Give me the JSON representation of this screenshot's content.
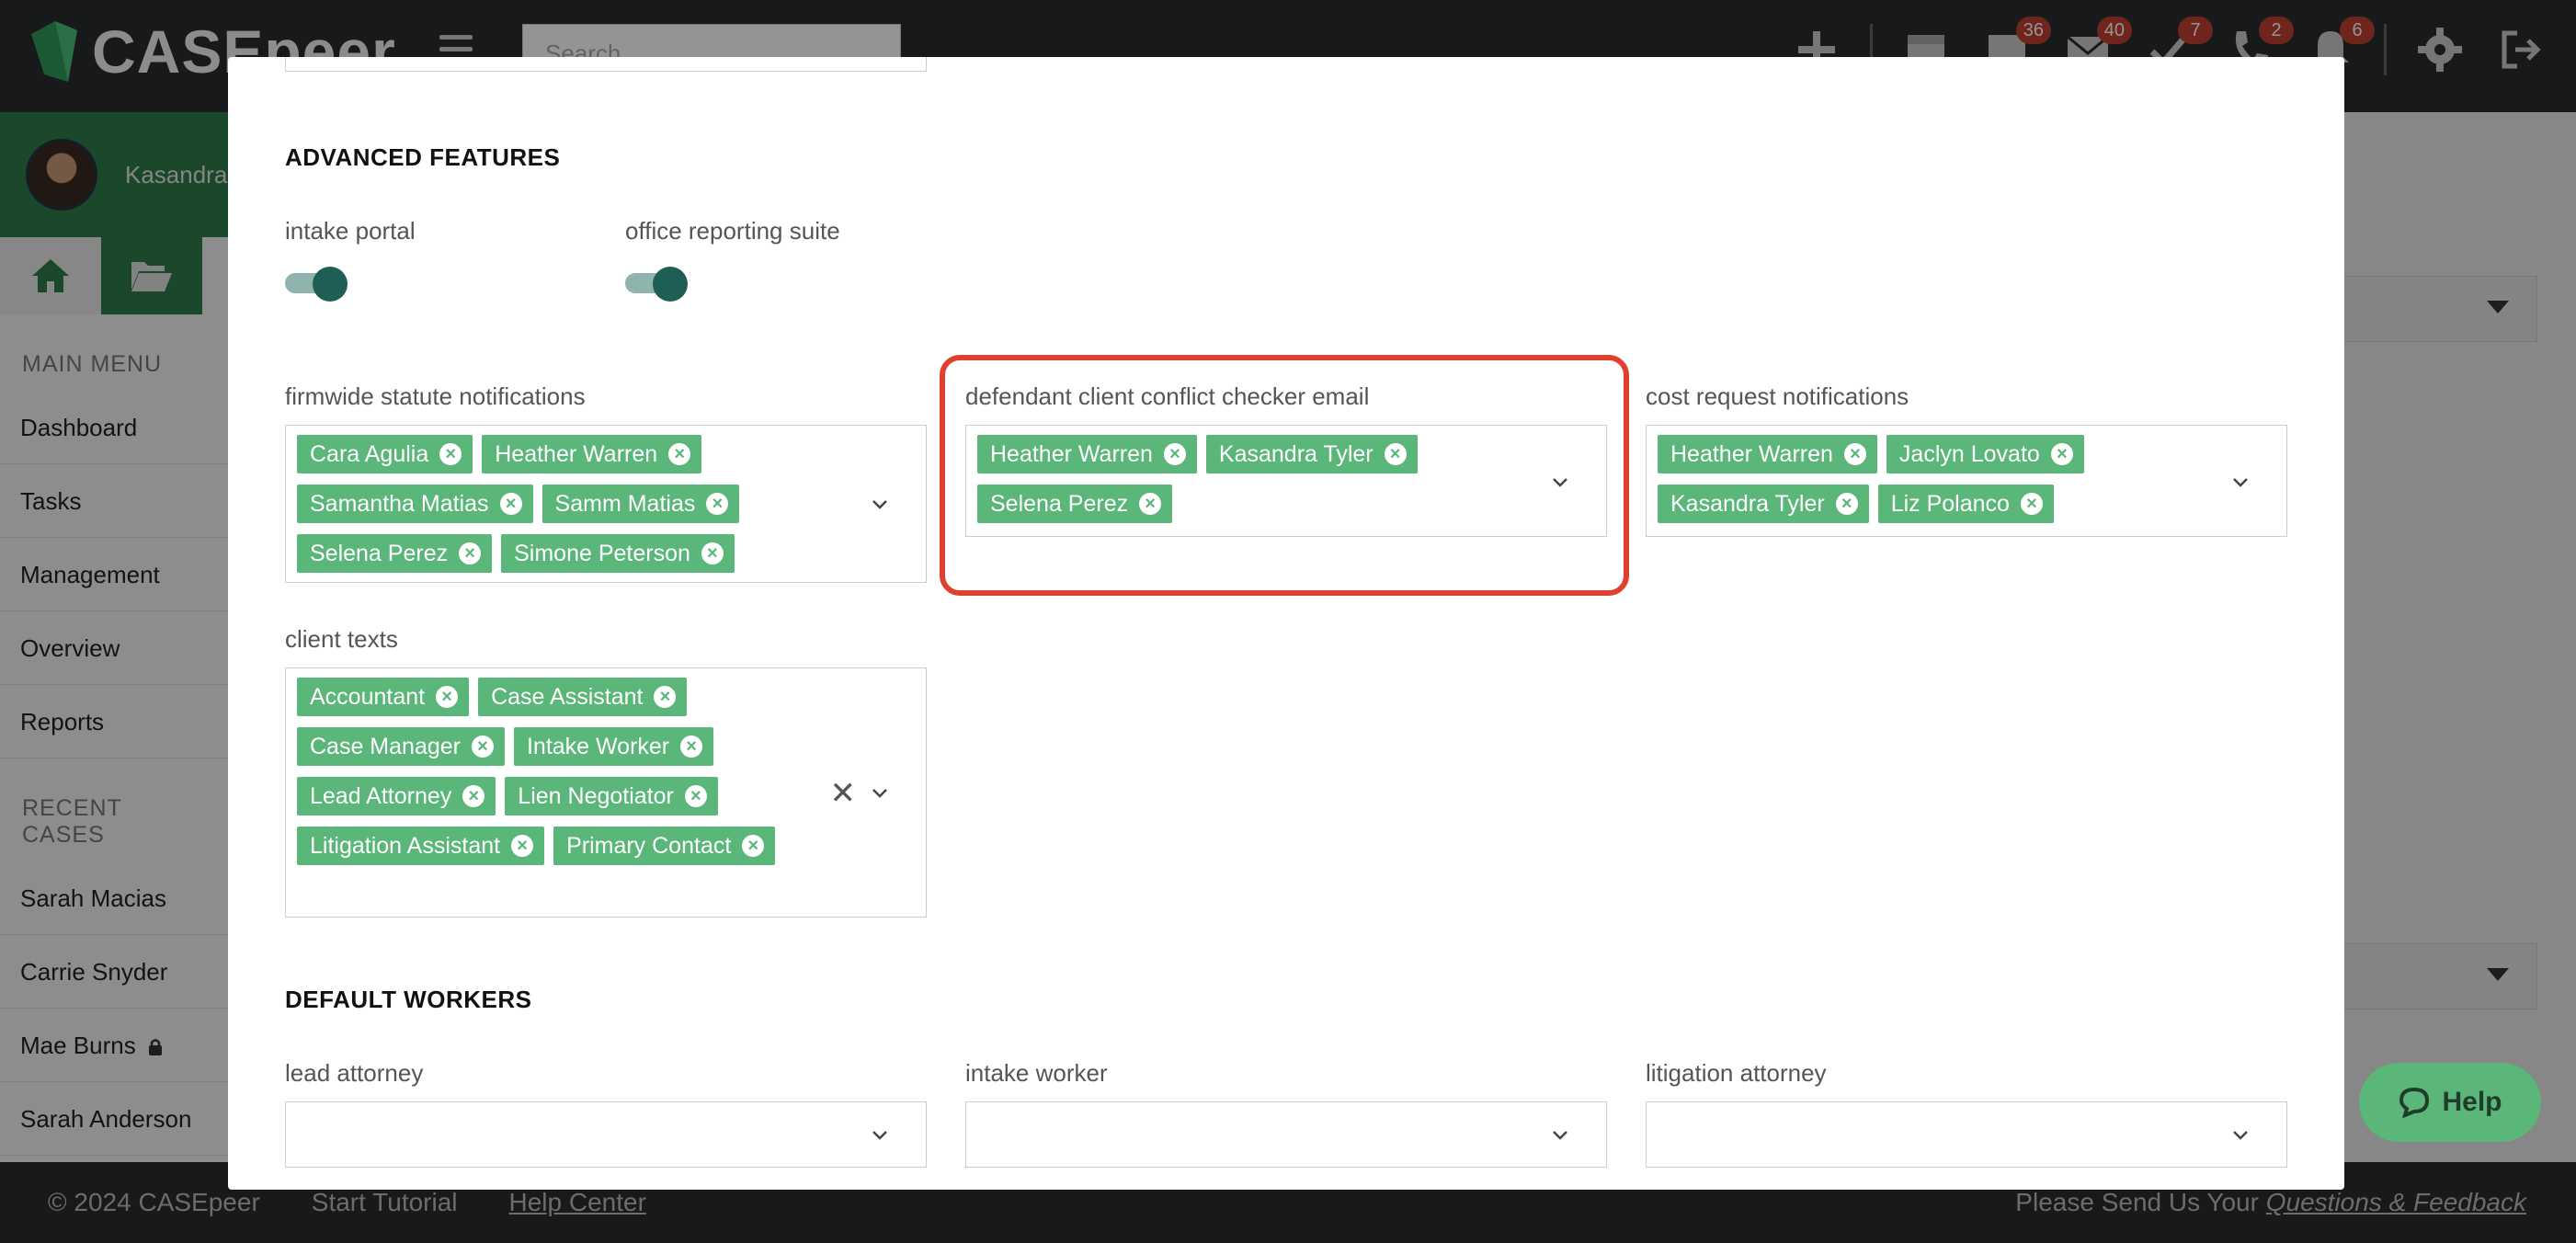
{
  "app": {
    "logo_text": "CASEpeer",
    "search_placeholder": "Search"
  },
  "topbar": {
    "badges": {
      "messages": "36",
      "mail": "40",
      "tasks": "7",
      "phone": "2",
      "alerts": "6"
    }
  },
  "sidebar": {
    "user_name": "Kasandra",
    "main_menu_heading": "MAIN MENU",
    "main_menu": [
      "Dashboard",
      "Tasks",
      "Management",
      "Overview",
      "Reports"
    ],
    "recent_heading": "RECENT CASES",
    "recent_cases": [
      "Sarah Macias",
      "Carrie Snyder",
      "Mae Burns",
      "Sarah Anderson"
    ]
  },
  "modal": {
    "advanced_title": "ADVANCED FEATURES",
    "intake_portal_label": "intake portal",
    "office_reporting_label": "office reporting suite",
    "firmwide": {
      "label": "firmwide statute notifications",
      "tags": [
        "Cara Agulia",
        "Heather Warren",
        "Samantha Matias",
        "Samm Matias",
        "Selena Perez",
        "Simone Peterson"
      ]
    },
    "defendant": {
      "label": "defendant client conflict checker email",
      "tags": [
        "Heather Warren",
        "Kasandra Tyler",
        "Selena Perez"
      ]
    },
    "cost": {
      "label": "cost request notifications",
      "tags": [
        "Heather Warren",
        "Jaclyn Lovato",
        "Kasandra Tyler",
        "Liz Polanco"
      ]
    },
    "client_texts": {
      "label": "client texts",
      "tags": [
        "Accountant",
        "Case Assistant",
        "Case Manager",
        "Intake Worker",
        "Lead Attorney",
        "Lien Negotiator",
        "Litigation Assistant",
        "Primary Contact"
      ]
    },
    "default_workers_title": "DEFAULT WORKERS",
    "lead_attorney_label": "lead attorney",
    "intake_worker_label": "intake worker",
    "litigation_attorney_label": "litigation attorney"
  },
  "help_button": "Help",
  "footer": {
    "copyright": "© 2024 CASEpeer",
    "start_tutorial": "Start Tutorial",
    "help_center": "Help Center",
    "feedback_prefix": "Please Send Us Your ",
    "feedback_link": "Questions & Feedback"
  },
  "colors": {
    "tag_green": "#5bb67a",
    "highlight_red": "#e0412f",
    "toggle_on": "#1f5e55"
  }
}
